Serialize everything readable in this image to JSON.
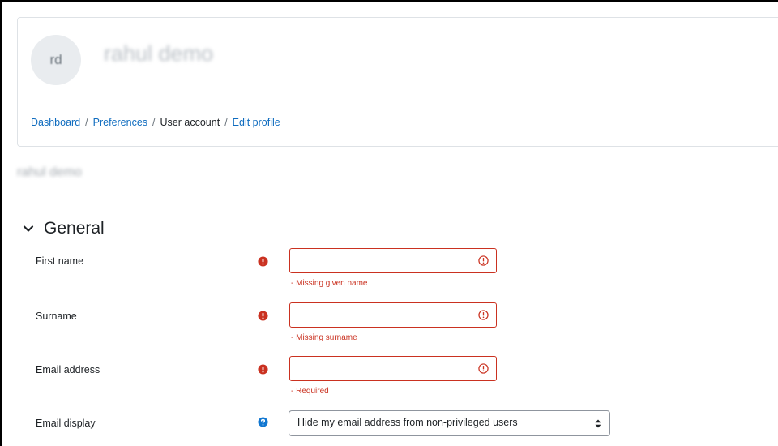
{
  "header": {
    "avatar_initials": "rd",
    "full_name": "rahul demo",
    "breadcrumb": [
      "Dashboard",
      "Preferences",
      "User account",
      "Edit profile"
    ]
  },
  "page": {
    "heading": "rahul demo"
  },
  "section": {
    "title": "General",
    "expanded": true
  },
  "form": {
    "first_name": {
      "label": "First name",
      "value": "",
      "error": "- Missing given name"
    },
    "surname": {
      "label": "Surname",
      "value": "",
      "error": "- Missing surname"
    },
    "email": {
      "label": "Email address",
      "value": "",
      "error": "- Required"
    },
    "email_display": {
      "label": "Email display",
      "selected": "Hide my email address from non-privileged users"
    }
  },
  "colors": {
    "error": "#ca3120",
    "link": "#0f6cbf",
    "help": "#1177d1"
  },
  "icons": {
    "required": "exclamation-circle-icon",
    "field_alert": "alert-circle-icon",
    "help": "question-circle-icon",
    "section": "chevron-down-icon",
    "select": "sort-caret-icon"
  }
}
